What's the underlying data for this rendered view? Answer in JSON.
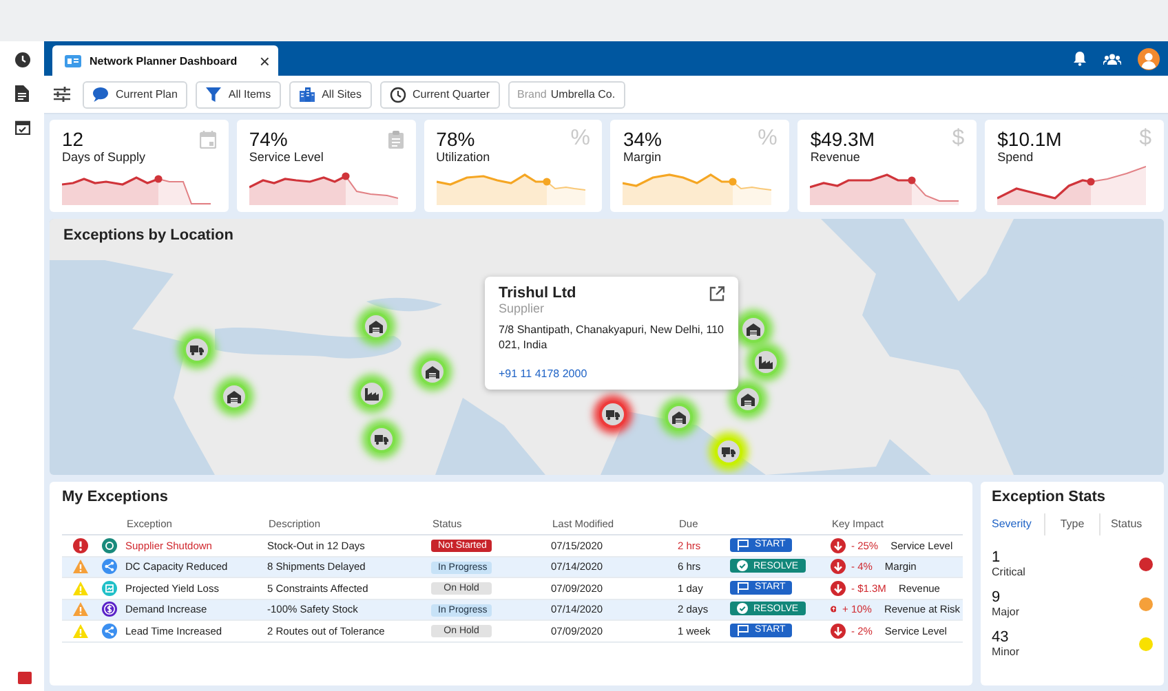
{
  "window": {
    "tab_title": "Network Planner Dashboard",
    "tab_close": "×"
  },
  "filters": [
    {
      "kind": "plan",
      "label": "Current Plan"
    },
    {
      "kind": "items",
      "label": "All Items"
    },
    {
      "kind": "sites",
      "label": "All Sites"
    },
    {
      "kind": "quarter",
      "label": "Current Quarter"
    },
    {
      "kind": "brand",
      "prefix": "Brand",
      "label": "Umbrella Co."
    }
  ],
  "kpis": [
    {
      "value": "12",
      "label": "Days of Supply",
      "kind": "calendar",
      "color": "#d0343a"
    },
    {
      "value": "74%",
      "label": "Service Level",
      "kind": "clipboard",
      "color": "#d0343a"
    },
    {
      "value": "78%",
      "label": "Utilization",
      "glyph": "%",
      "color": "#f5a623"
    },
    {
      "value": "34%",
      "label": "Margin",
      "glyph": "%",
      "color": "#f5a623"
    },
    {
      "value": "$49.3M",
      "label": "Revenue",
      "glyph": "$",
      "color": "#d0343a"
    },
    {
      "value": "$10.1M",
      "label": "Spend",
      "glyph": "$",
      "color": "#d0343a"
    }
  ],
  "map": {
    "title": "Exceptions by Location",
    "markers": [
      {
        "kind": "truck",
        "color": "#7ee04a"
      },
      {
        "kind": "warehouse",
        "color": "#7ee04a"
      },
      {
        "kind": "warehouse",
        "color": "#7ee04a"
      },
      {
        "kind": "warehouse",
        "color": "#7ee04a"
      },
      {
        "kind": "factory",
        "color": "#7ee04a"
      },
      {
        "kind": "truck",
        "color": "#7ee04a"
      },
      {
        "kind": "truck",
        "color": "#ee3b3b"
      },
      {
        "kind": "warehouse",
        "color": "#7ee04a"
      },
      {
        "kind": "warehouse",
        "color": "#7ee04a"
      },
      {
        "kind": "factory",
        "color": "#7ee04a"
      },
      {
        "kind": "warehouse",
        "color": "#7ee04a"
      },
      {
        "kind": "truck",
        "color": "#c8f000"
      }
    ],
    "popup": {
      "name": "Trishul Ltd",
      "role": "Supplier",
      "address": "7/8 Shantipath, Chanakyapuri, New Delhi, 110 021, India",
      "phone": "+91 11 4178 2000"
    }
  },
  "exceptions": {
    "title": "My Exceptions",
    "columns": [
      "Exception",
      "Description",
      "Status",
      "Last Modified",
      "Due",
      "Key Impact"
    ],
    "rows": [
      {
        "severity": {
          "kind": "critical"
        },
        "type": {
          "kind": "supplier"
        },
        "exception": "Supplier Shutdown",
        "description": "Stock-Out in 12 Days",
        "status": {
          "kind": "not_started",
          "label": "Not Started"
        },
        "modified": "07/15/2020",
        "due": "2 hrs",
        "urgent": true,
        "action": {
          "kind": "start",
          "label": "START"
        },
        "impact": {
          "kind": "down",
          "value": "- 25%",
          "metric": "Service Level"
        }
      },
      {
        "severity": {
          "kind": "major"
        },
        "type": {
          "kind": "share"
        },
        "exception": "DC Capacity Reduced",
        "description": "8 Shipments Delayed",
        "status": {
          "kind": "in_progress",
          "label": "In Progress"
        },
        "modified": "07/14/2020",
        "due": "6 hrs",
        "urgent": false,
        "action": {
          "kind": "resolve",
          "label": "RESOLVE"
        },
        "impact": {
          "kind": "down",
          "value": "- 4%",
          "metric": "Margin"
        }
      },
      {
        "severity": {
          "kind": "minor"
        },
        "type": {
          "kind": "yield"
        },
        "exception": "Projected Yield Loss",
        "description": "5 Constraints Affected",
        "status": {
          "kind": "on_hold",
          "label": "On Hold"
        },
        "modified": "07/09/2020",
        "due": "1 day",
        "urgent": false,
        "action": {
          "kind": "start",
          "label": "START"
        },
        "impact": {
          "kind": "down",
          "value": "- $1.3M",
          "metric": "Revenue"
        }
      },
      {
        "severity": {
          "kind": "major"
        },
        "type": {
          "kind": "dollar"
        },
        "exception": "Demand Increase",
        "description": "-100% Safety Stock",
        "status": {
          "kind": "in_progress",
          "label": "In Progress"
        },
        "modified": "07/14/2020",
        "due": "2 days",
        "urgent": false,
        "action": {
          "kind": "resolve",
          "label": "RESOLVE"
        },
        "impact": {
          "kind": "up",
          "value": "+ 10%",
          "metric": "Revenue at Risk"
        }
      },
      {
        "severity": {
          "kind": "minor"
        },
        "type": {
          "kind": "share"
        },
        "exception": "Lead Time Increased",
        "description": "2 Routes out of Tolerance",
        "status": {
          "kind": "on_hold",
          "label": "On Hold"
        },
        "modified": "07/09/2020",
        "due": "1 week",
        "urgent": false,
        "action": {
          "kind": "start",
          "label": "START"
        },
        "impact": {
          "kind": "down",
          "value": "- 2%",
          "metric": "Service Level"
        }
      }
    ]
  },
  "stats": {
    "title": "Exception Stats",
    "tabs": [
      {
        "label": "Severity",
        "selected": true
      },
      {
        "label": "Type",
        "selected": false
      },
      {
        "label": "Status",
        "selected": false
      }
    ],
    "items": [
      {
        "count": "1",
        "label": "Critical",
        "color": "#d0282e"
      },
      {
        "count": "9",
        "label": "Major",
        "color": "#f5a03a"
      },
      {
        "count": "43",
        "label": "Minor",
        "color": "#f8e000"
      }
    ]
  }
}
